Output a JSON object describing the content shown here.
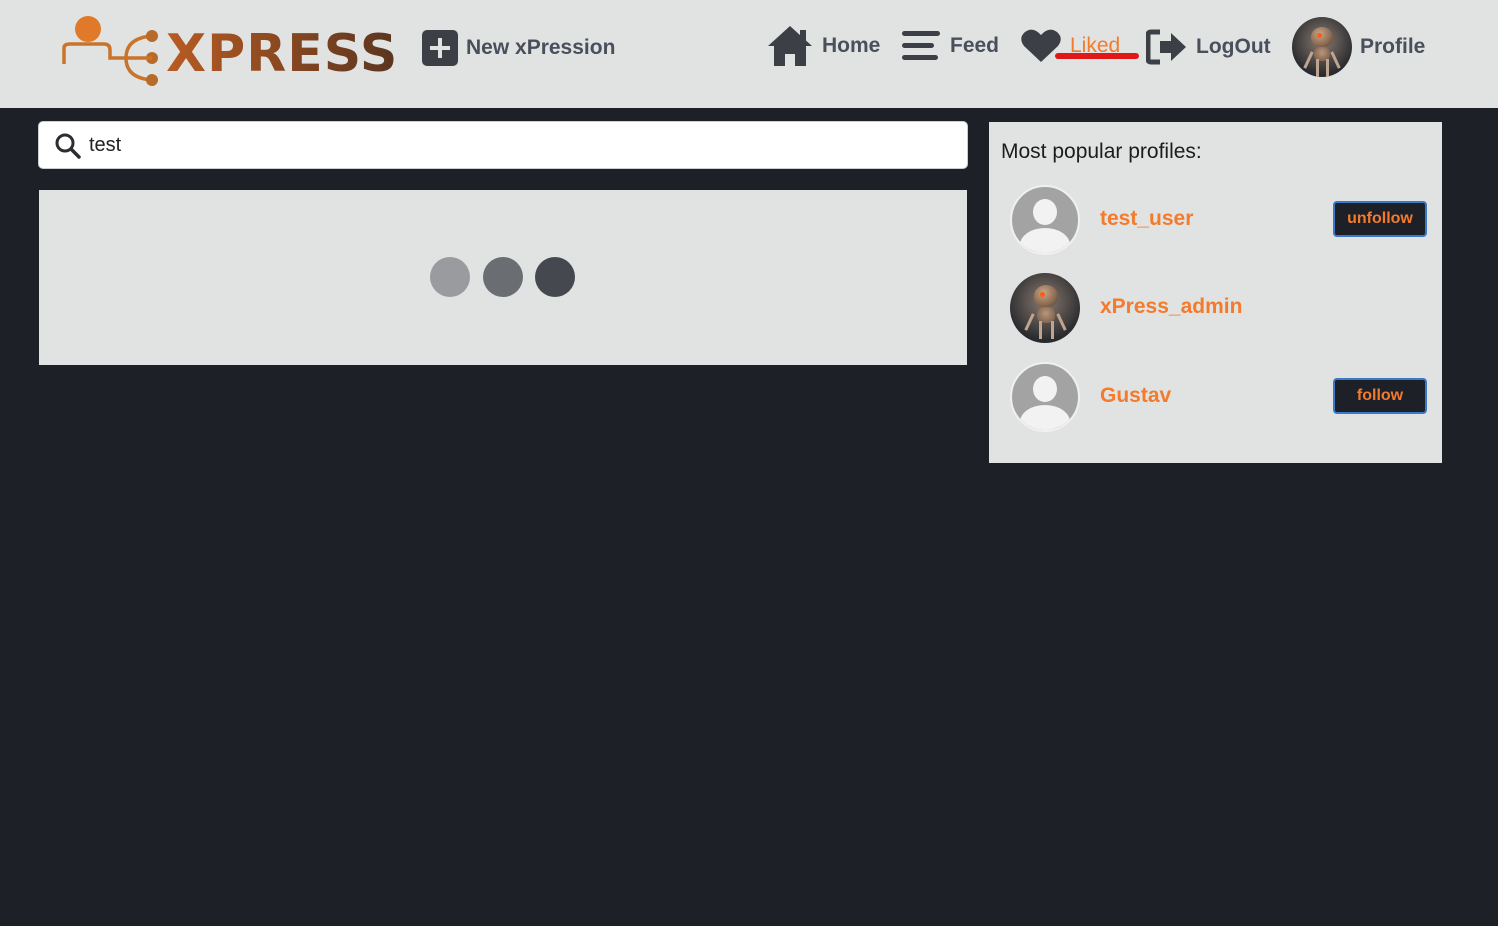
{
  "header": {
    "logo_text": "XPRESS",
    "nav": {
      "new_label": "New xPression",
      "home_label": "Home",
      "feed_label": "Feed",
      "liked_label": "Liked",
      "logout_label": "LogOut",
      "profile_label": "Profile"
    },
    "active_item": "Liked"
  },
  "search": {
    "value": "test"
  },
  "results": {
    "state": "loading"
  },
  "sidebar": {
    "title": "Most popular profiles:",
    "profiles": [
      {
        "name": "test_user",
        "avatar": "default-avatar",
        "button_label": "unfollow"
      },
      {
        "name": "xPress_admin",
        "avatar": "robot-avatar",
        "button_label": ""
      },
      {
        "name": "Gustav",
        "avatar": "default-avatar",
        "button_label": "follow"
      }
    ]
  },
  "colors": {
    "background": "#1e2028",
    "panel": "#e1e3e3",
    "accent": "#f47a2c",
    "nav_text": "#4a4f5c",
    "active_underline": "#e11818"
  }
}
